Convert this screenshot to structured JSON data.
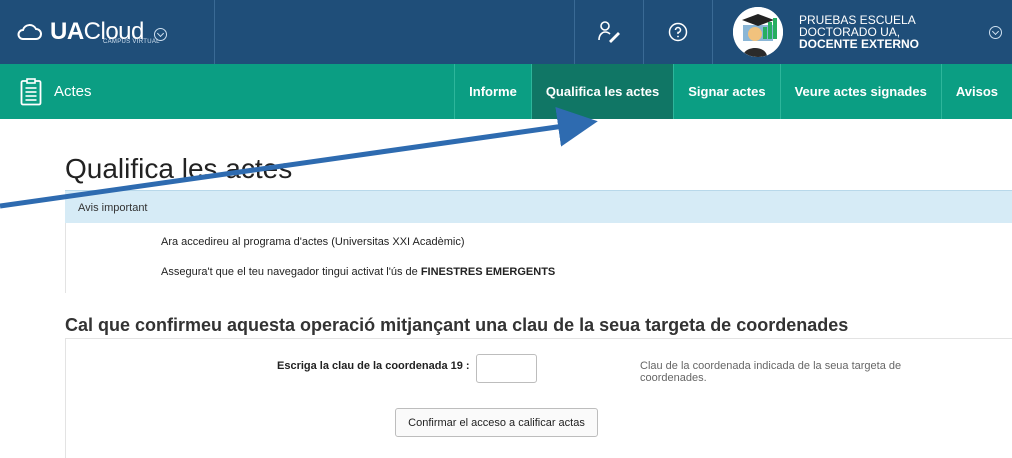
{
  "header": {
    "brand_bold": "UA",
    "brand_light": "Cloud",
    "brand_sub": "CAMPUS VIRTUAL",
    "user": {
      "line1": "PRUEBAS ESCUELA",
      "line2": "DOCTORADO UA,",
      "line3": "DOCENTE EXTERNO"
    }
  },
  "nav": {
    "section": "Actes",
    "items": [
      {
        "label": "Informe"
      },
      {
        "label": "Qualifica les actes",
        "active": true
      },
      {
        "label": "Signar actes"
      },
      {
        "label": "Veure actes signades"
      },
      {
        "label": "Avisos"
      }
    ]
  },
  "page": {
    "title": "Qualifica les actes",
    "notice_header": "Avis important",
    "notice_line1": "Ara accedireu al programa d'actes (Universitas XXI Acadèmic)",
    "notice_line2_prefix": "Assegura't que el teu navegador tingui activat l'ús de ",
    "notice_line2_bold": "FINESTRES EMERGENTS",
    "confirm_title": "Cal que confirmeu aquesta operació mitjançant una clau de la seua targeta de coordenades",
    "coord_label": "Escriga la clau de la coordenada 19 :",
    "coord_value": "",
    "coord_help": "Clau de la coordenada indicada de la seua targeta de coordenades.",
    "confirm_button": "Confirmar el acceso a calificar actas"
  },
  "colors": {
    "topbar": "#1f4e79",
    "navbar": "#0b9e83",
    "nav_active": "#107665",
    "notice_bg": "#d6ebf6",
    "annotation_arrow": "#2e6bb0"
  },
  "icons": [
    "cloud-icon",
    "chevron-down-icon",
    "user-signature-icon",
    "help-icon",
    "avatar",
    "clipboard-icon",
    "annotation-arrow"
  ]
}
